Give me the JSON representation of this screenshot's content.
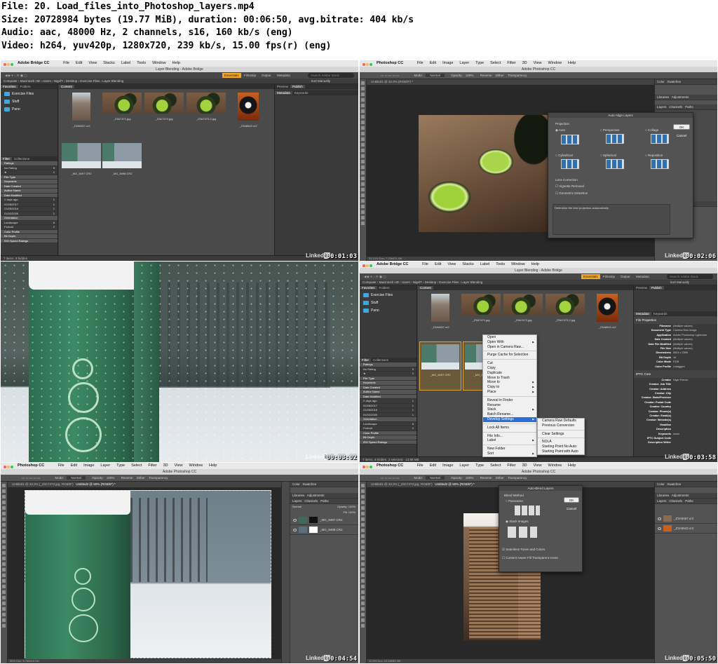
{
  "header": {
    "file_line": "File: 20. Load_files_into_Photoshop_layers.mp4",
    "size_line": "Size: 20728984 bytes (19.77 MiB), duration: 00:06:50, avg.bitrate: 404 kb/s",
    "audio_line": "Audio: aac, 48000 Hz, 2 channels, s16, 160 kb/s (eng)",
    "video_line": "Video: h264, yuv420p, 1280x720, 239 kb/s, 15.00 fps(r) (eng)"
  },
  "watermark": "LinkedIn LEARNING",
  "frames": [
    {
      "timestamp": "00:01:03",
      "app": "Adobe Bridge CC",
      "menu": [
        "File",
        "Edit",
        "View",
        "Stacks",
        "Label",
        "Tools",
        "Window",
        "Help"
      ],
      "window_title": "Layer Blending - Adobe Bridge",
      "workspace_tabs": [
        "Essentials",
        "Filmstrip",
        "Output",
        "Metadata"
      ],
      "search_placeholder": "Search Adobe Stock",
      "path": [
        "Computer",
        "Macintosh HD",
        "Users",
        "NigelT",
        "Desktop",
        "Exercise Files",
        "Layer Blending"
      ],
      "sort": "Sort Manually",
      "panel_tabs": [
        "Favorites",
        "Folders"
      ],
      "folders": [
        "Exercise Files",
        "Stuff",
        "Pano"
      ],
      "content_tab": "Content",
      "preview_tabs": [
        "Preview",
        "Publish"
      ],
      "metadata_tabs": [
        "Metadata",
        "Keywords"
      ],
      "filter_tabs": [
        "Filter",
        "Collections"
      ],
      "filters": [
        {
          "label": "Ratings",
          "count": "",
          "header": true
        },
        {
          "label": "No Rating",
          "count": "5"
        },
        {
          "label": "★",
          "count": "2"
        },
        {
          "label": "File Type",
          "count": "",
          "header": true
        },
        {
          "label": "Keywords",
          "count": "",
          "header": true
        },
        {
          "label": "Date Created",
          "count": "",
          "header": true
        },
        {
          "label": "Author Name",
          "count": "",
          "header": true
        },
        {
          "label": "Date Modified",
          "count": "",
          "header": true
        },
        {
          "label": "2 days ago",
          "count": "1"
        },
        {
          "label": "02/08/2017",
          "count": "1"
        },
        {
          "label": "21/05/2016",
          "count": "1"
        },
        {
          "label": "01/02/2009",
          "count": "1"
        },
        {
          "label": "Orientation",
          "count": "",
          "header": true
        },
        {
          "label": "Landscape",
          "count": "6"
        },
        {
          "label": "Portrait",
          "count": "2"
        },
        {
          "label": "Color Profile",
          "count": "",
          "header": true
        },
        {
          "label": "Bit Depth",
          "count": "",
          "header": true
        },
        {
          "label": "ISO Speed Ratings",
          "count": "",
          "header": true
        }
      ],
      "thumbnails": [
        "_Z3A5457.cr2",
        "_Z3A7471.jpg",
        "_Z3A7472.jpg",
        "_Z3A7473-2.jpg",
        "_Z3A8642.cr2",
        "_MG_8497.CR2",
        "_MG_8498.CR2"
      ],
      "status": "7 items, 8 hidden"
    },
    {
      "timestamp": "00:02:06",
      "app": "Photoshop CC",
      "menu": [
        "File",
        "Edit",
        "Image",
        "Layer",
        "Type",
        "Select",
        "Filter",
        "3D",
        "View",
        "Window",
        "Help"
      ],
      "window_title": "Adobe Photoshop CC",
      "options": [
        "Mode:",
        "Normal",
        "Opacity:",
        "100%",
        "Reverse",
        "Dither",
        "Transparency"
      ],
      "doc_tab": "Untitled1 @ 33.3% (RGB/8*) *",
      "status": "33.33%   Doc: 7.03M/21.0M",
      "dialog": {
        "title": "Auto-Align Layers",
        "section": "Projection",
        "options": [
          "Auto",
          "Perspective",
          "Collage",
          "Cylindrical",
          "Spherical",
          "Reposition"
        ],
        "lens_label": "Lens Correction",
        "checks": [
          "Vignette Removal",
          "Geometric Distortion"
        ],
        "ok": "OK",
        "cancel": "Cancel",
        "description": "Determine the best projection automatically."
      },
      "panels": [
        "Color",
        "Swatches",
        "Libraries",
        "Adjustments",
        "Layers",
        "Channels",
        "Paths",
        "Properties"
      ]
    },
    {
      "timestamp": "00:03:02"
    },
    {
      "timestamp": "00:03:58",
      "app": "Adobe Bridge CC",
      "window_title": "Layer Blending - Adobe Bridge",
      "context_menu": [
        {
          "label": "Open"
        },
        {
          "label": "Open With",
          "sub": true
        },
        {
          "label": "Open in Camera Raw..."
        },
        {
          "sep": true
        },
        {
          "label": "Purge Cache for Selection"
        },
        {
          "sep": true
        },
        {
          "label": "Cut"
        },
        {
          "label": "Copy"
        },
        {
          "label": "Duplicate"
        },
        {
          "label": "Move to Trash"
        },
        {
          "label": "Move to",
          "sub": true
        },
        {
          "label": "Copy to",
          "sub": true
        },
        {
          "label": "Place",
          "sub": true
        },
        {
          "sep": true
        },
        {
          "label": "Reveal in Finder"
        },
        {
          "label": "Rename"
        },
        {
          "label": "Stack",
          "sub": true
        },
        {
          "label": "Batch Rename..."
        },
        {
          "label": "Develop Settings",
          "sub": true,
          "hl": true
        },
        {
          "sep": true
        },
        {
          "label": "Lock All Items"
        },
        {
          "sep": true
        },
        {
          "label": "File Info..."
        },
        {
          "label": "Label",
          "sub": true
        },
        {
          "sep": true
        },
        {
          "label": "New Folder"
        },
        {
          "label": "Sort",
          "sub": true
        }
      ],
      "submenu": [
        "Camera Raw Defaults",
        "Previous Conversion",
        "",
        "Clear Settings",
        "",
        "NOLA",
        "Starting Point No Auto",
        "Starting Point with Auto"
      ],
      "file_properties_title": "File Properties",
      "file_properties": [
        [
          "Filename",
          "(Multiple values)"
        ],
        [
          "Document Type",
          "Camera Raw image"
        ],
        [
          "Application",
          "Adobe Photoshop Lightroom"
        ],
        [
          "Date Created",
          "(Multiple values)"
        ],
        [
          "Date File Modified",
          "(Multiple values)"
        ],
        [
          "File Size",
          "(Multiple values)"
        ],
        [
          "Dimensions",
          "5604 x 3396"
        ],
        [
          "Bit Depth",
          "16"
        ],
        [
          "Color Mode",
          "RGB"
        ],
        [
          "Color Profile",
          "Untagged"
        ]
      ],
      "iptc_title": "IPTC Core",
      "iptc": [
        [
          "Creator",
          "Nigel French"
        ],
        [
          "Creator: Job Title",
          ""
        ],
        [
          "Creator: Address",
          ""
        ],
        [
          "Creator: City",
          ""
        ],
        [
          "Creator: State/Province",
          ""
        ],
        [
          "Creator: Postal Code",
          ""
        ],
        [
          "Creator: Country",
          ""
        ],
        [
          "Creator: Phone(s)",
          ""
        ],
        [
          "Creator: Email(s)",
          ""
        ],
        [
          "Creator: Website(s)",
          ""
        ],
        [
          "Headline",
          ""
        ],
        [
          "Description",
          ""
        ],
        [
          "Keywords",
          "snow"
        ],
        [
          "IPTC Subject Code",
          ""
        ],
        [
          "Description Writer",
          ""
        ]
      ],
      "status": "7 items, 8 hidden, 2 selected - 13.98 MB"
    },
    {
      "timestamp": "00:04:54",
      "app": "Photoshop CC",
      "doc_tabs": [
        "Untitled1 @ 33.3% (_Z3A7472.jpg, RGB/8*)",
        "Untitled2 @ 50% (RGB/8*) *"
      ],
      "layers": [
        "_MG_8497.CR2",
        "_MG_8498.CR2"
      ],
      "blend": "Normal",
      "opacity": "Opacity: 100%",
      "fill": "Fill: 100%",
      "status": "50%   Doc: 6.78M/18.0M"
    },
    {
      "timestamp": "00:05:50",
      "app": "Photoshop CC",
      "doc_tabs": [
        "Untitled1 @ 33.3% (_Z3A7472.jpg, RGB/8*)",
        "Untitled2 @ 50% (RGB/8*) *"
      ],
      "dialog": {
        "title": "Auto-Blend Layers",
        "section": "Blend Method",
        "options": [
          "Panorama",
          "Stack Images"
        ],
        "checks": [
          "Seamless Tones and Colors",
          "Content Aware Fill Transparent Areas"
        ],
        "ok": "OK",
        "cancel": "Cancel"
      },
      "layers": [
        "_Z3A5457.cr2",
        "_Z3A8642.cr2"
      ],
      "status": "12.5%   Doc: 24.4M/89.2M"
    }
  ]
}
